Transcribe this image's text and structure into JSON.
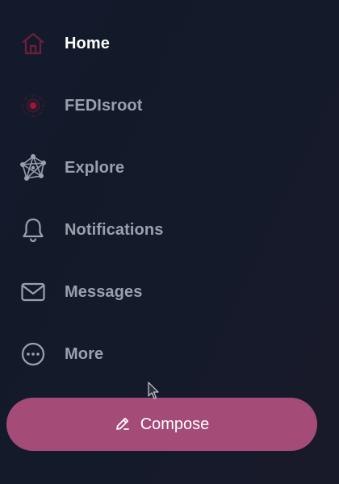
{
  "nav": {
    "items": [
      {
        "label": "Home",
        "icon": "home-icon",
        "active": true
      },
      {
        "label": "FEDIsroot",
        "icon": "fedi-icon",
        "active": false
      },
      {
        "label": "Explore",
        "icon": "network-icon",
        "active": false
      },
      {
        "label": "Notifications",
        "icon": "bell-icon",
        "active": false
      },
      {
        "label": "Messages",
        "icon": "mail-icon",
        "active": false
      },
      {
        "label": "More",
        "icon": "more-icon",
        "active": false
      }
    ]
  },
  "compose": {
    "label": "Compose",
    "icon": "pencil-icon",
    "color": "#a44c77"
  },
  "colors": {
    "background": "#131a2a",
    "active_text": "#ffffff",
    "inactive_text": "#9aa1ad",
    "home_icon": "#6b1f3a",
    "fedi_icon": "#8b1e3a"
  }
}
